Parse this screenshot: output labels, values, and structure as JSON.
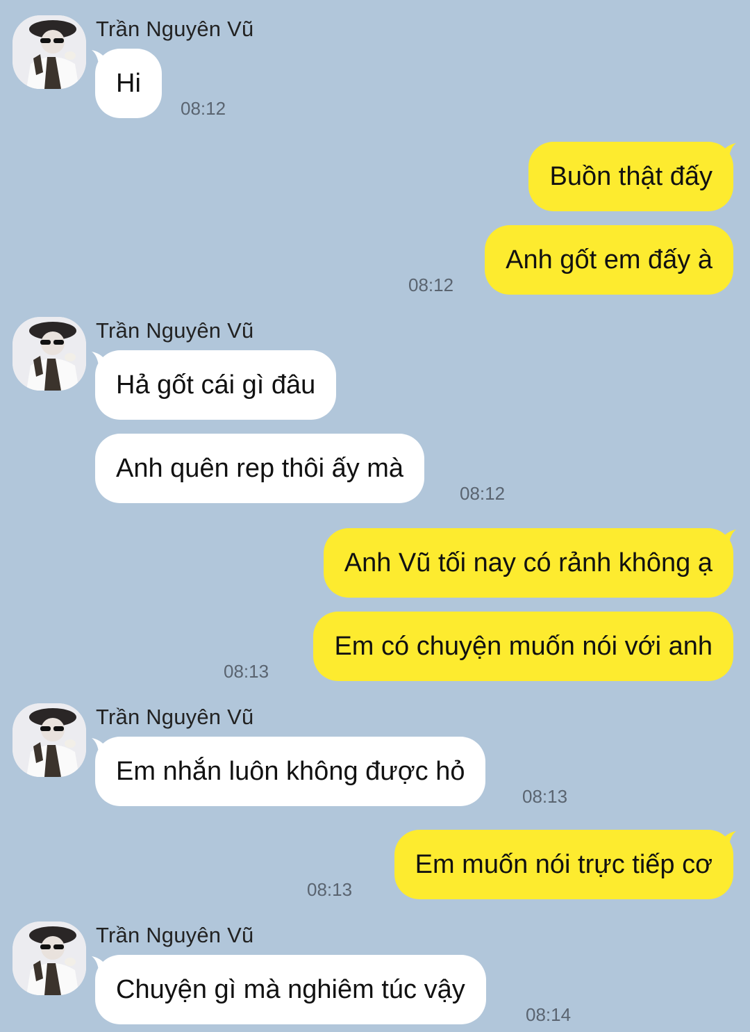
{
  "contact": {
    "name": "Trần Nguyên Vũ"
  },
  "colors": {
    "background": "#b1c6da",
    "incoming_bubble": "#ffffff",
    "outgoing_bubble": "#fdeb2f"
  },
  "messages": [
    {
      "direction": "in",
      "text": "Hi",
      "time": "08:12"
    },
    {
      "direction": "out",
      "text": "Buồn thật đấy",
      "time": ""
    },
    {
      "direction": "out",
      "text": "Anh gốt em đấy à",
      "time": "08:12"
    },
    {
      "direction": "in",
      "text": "Hả gốt cái gì đâu",
      "time": ""
    },
    {
      "direction": "in",
      "text": "Anh quên rep thôi ấy mà",
      "time": "08:12"
    },
    {
      "direction": "out",
      "text": "Anh Vũ tối nay có rảnh không ạ",
      "time": ""
    },
    {
      "direction": "out",
      "text": "Em có chuyện muốn nói với anh",
      "time": "08:13"
    },
    {
      "direction": "in",
      "text": "Em nhắn luôn không được hỏ",
      "time": "08:13"
    },
    {
      "direction": "out",
      "text": "Em muốn nói trực tiếp cơ",
      "time": "08:13"
    },
    {
      "direction": "in",
      "text": "Chuyện gì mà nghiêm túc vậy",
      "time": "08:14"
    }
  ],
  "icons": {
    "avatar": "contact-avatar-photo"
  }
}
